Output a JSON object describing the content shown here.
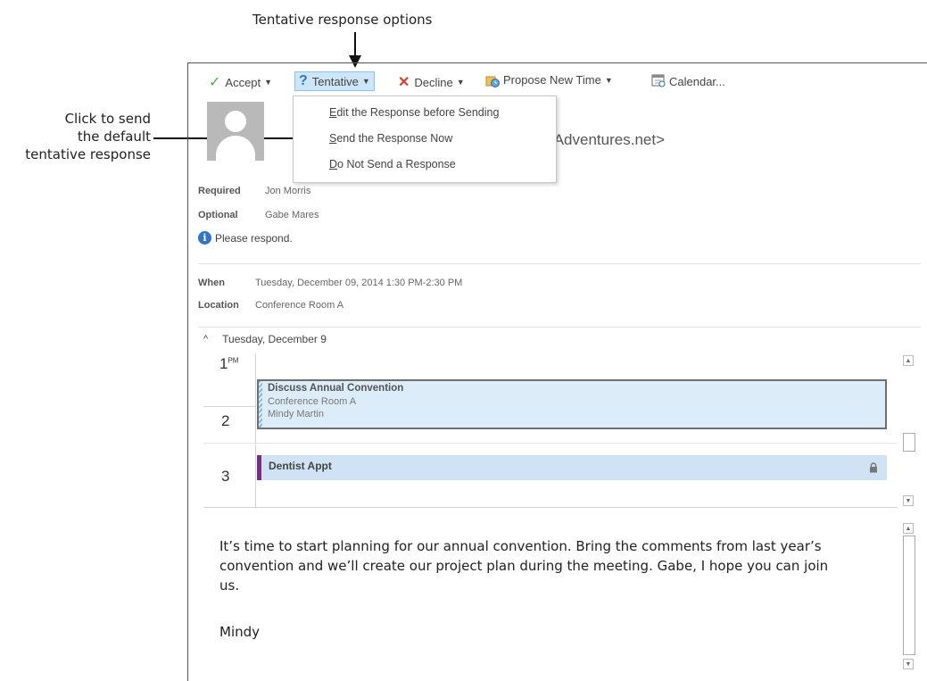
{
  "callouts": {
    "top": "Tentative response options",
    "left_line1": "Click to send",
    "left_line2": "the default",
    "left_line3": "tentative response"
  },
  "toolbar": {
    "accept": "Accept",
    "tentative": "Tentative",
    "decline": "Decline",
    "propose": "Propose New Time",
    "calendar": "Calendar..."
  },
  "menu": {
    "item1_key": "E",
    "item1_rest": "dit the Response before Sending",
    "item2_key": "S",
    "item2_rest": "end the Response Now",
    "item3_key": "D",
    "item3_rest": "o Not Send a Response"
  },
  "sender_email_fragment": "tAdventures.net>",
  "attendees": {
    "required_label": "Required",
    "required_value": "Jon Morris",
    "optional_label": "Optional",
    "optional_value": "Gabe Mares",
    "info": "Please respond."
  },
  "details": {
    "when_label": "When",
    "when_value": "Tuesday, December 09, 2014 1:30 PM-2:30 PM",
    "location_label": "Location",
    "location_value": "Conference Room A"
  },
  "calendar": {
    "date_header": "Tuesday, December 9",
    "hour1": "1",
    "hour1_suffix": "PM",
    "hour2": "2",
    "hour3": "3",
    "meeting_title": "Discuss Annual Convention",
    "meeting_location": "Conference Room A",
    "meeting_organizer": "Mindy Martin",
    "dentist": "Dentist Appt"
  },
  "message": {
    "line1": "It’s time to start planning for our annual convention. Bring the comments from last year’s",
    "line2": "convention and we’ll create our project plan during the meeting. Gabe, I hope you can join",
    "line3": "us.",
    "signature": "Mindy"
  },
  "colors": {
    "accept_check": "#5aa84a",
    "tentative_q": "#2f75c9",
    "decline_x": "#d8402a",
    "dentist_bar": "#7a2a8c",
    "appointment_bg": "#cfe3f4",
    "menu_highlight": "#cde6f7"
  }
}
